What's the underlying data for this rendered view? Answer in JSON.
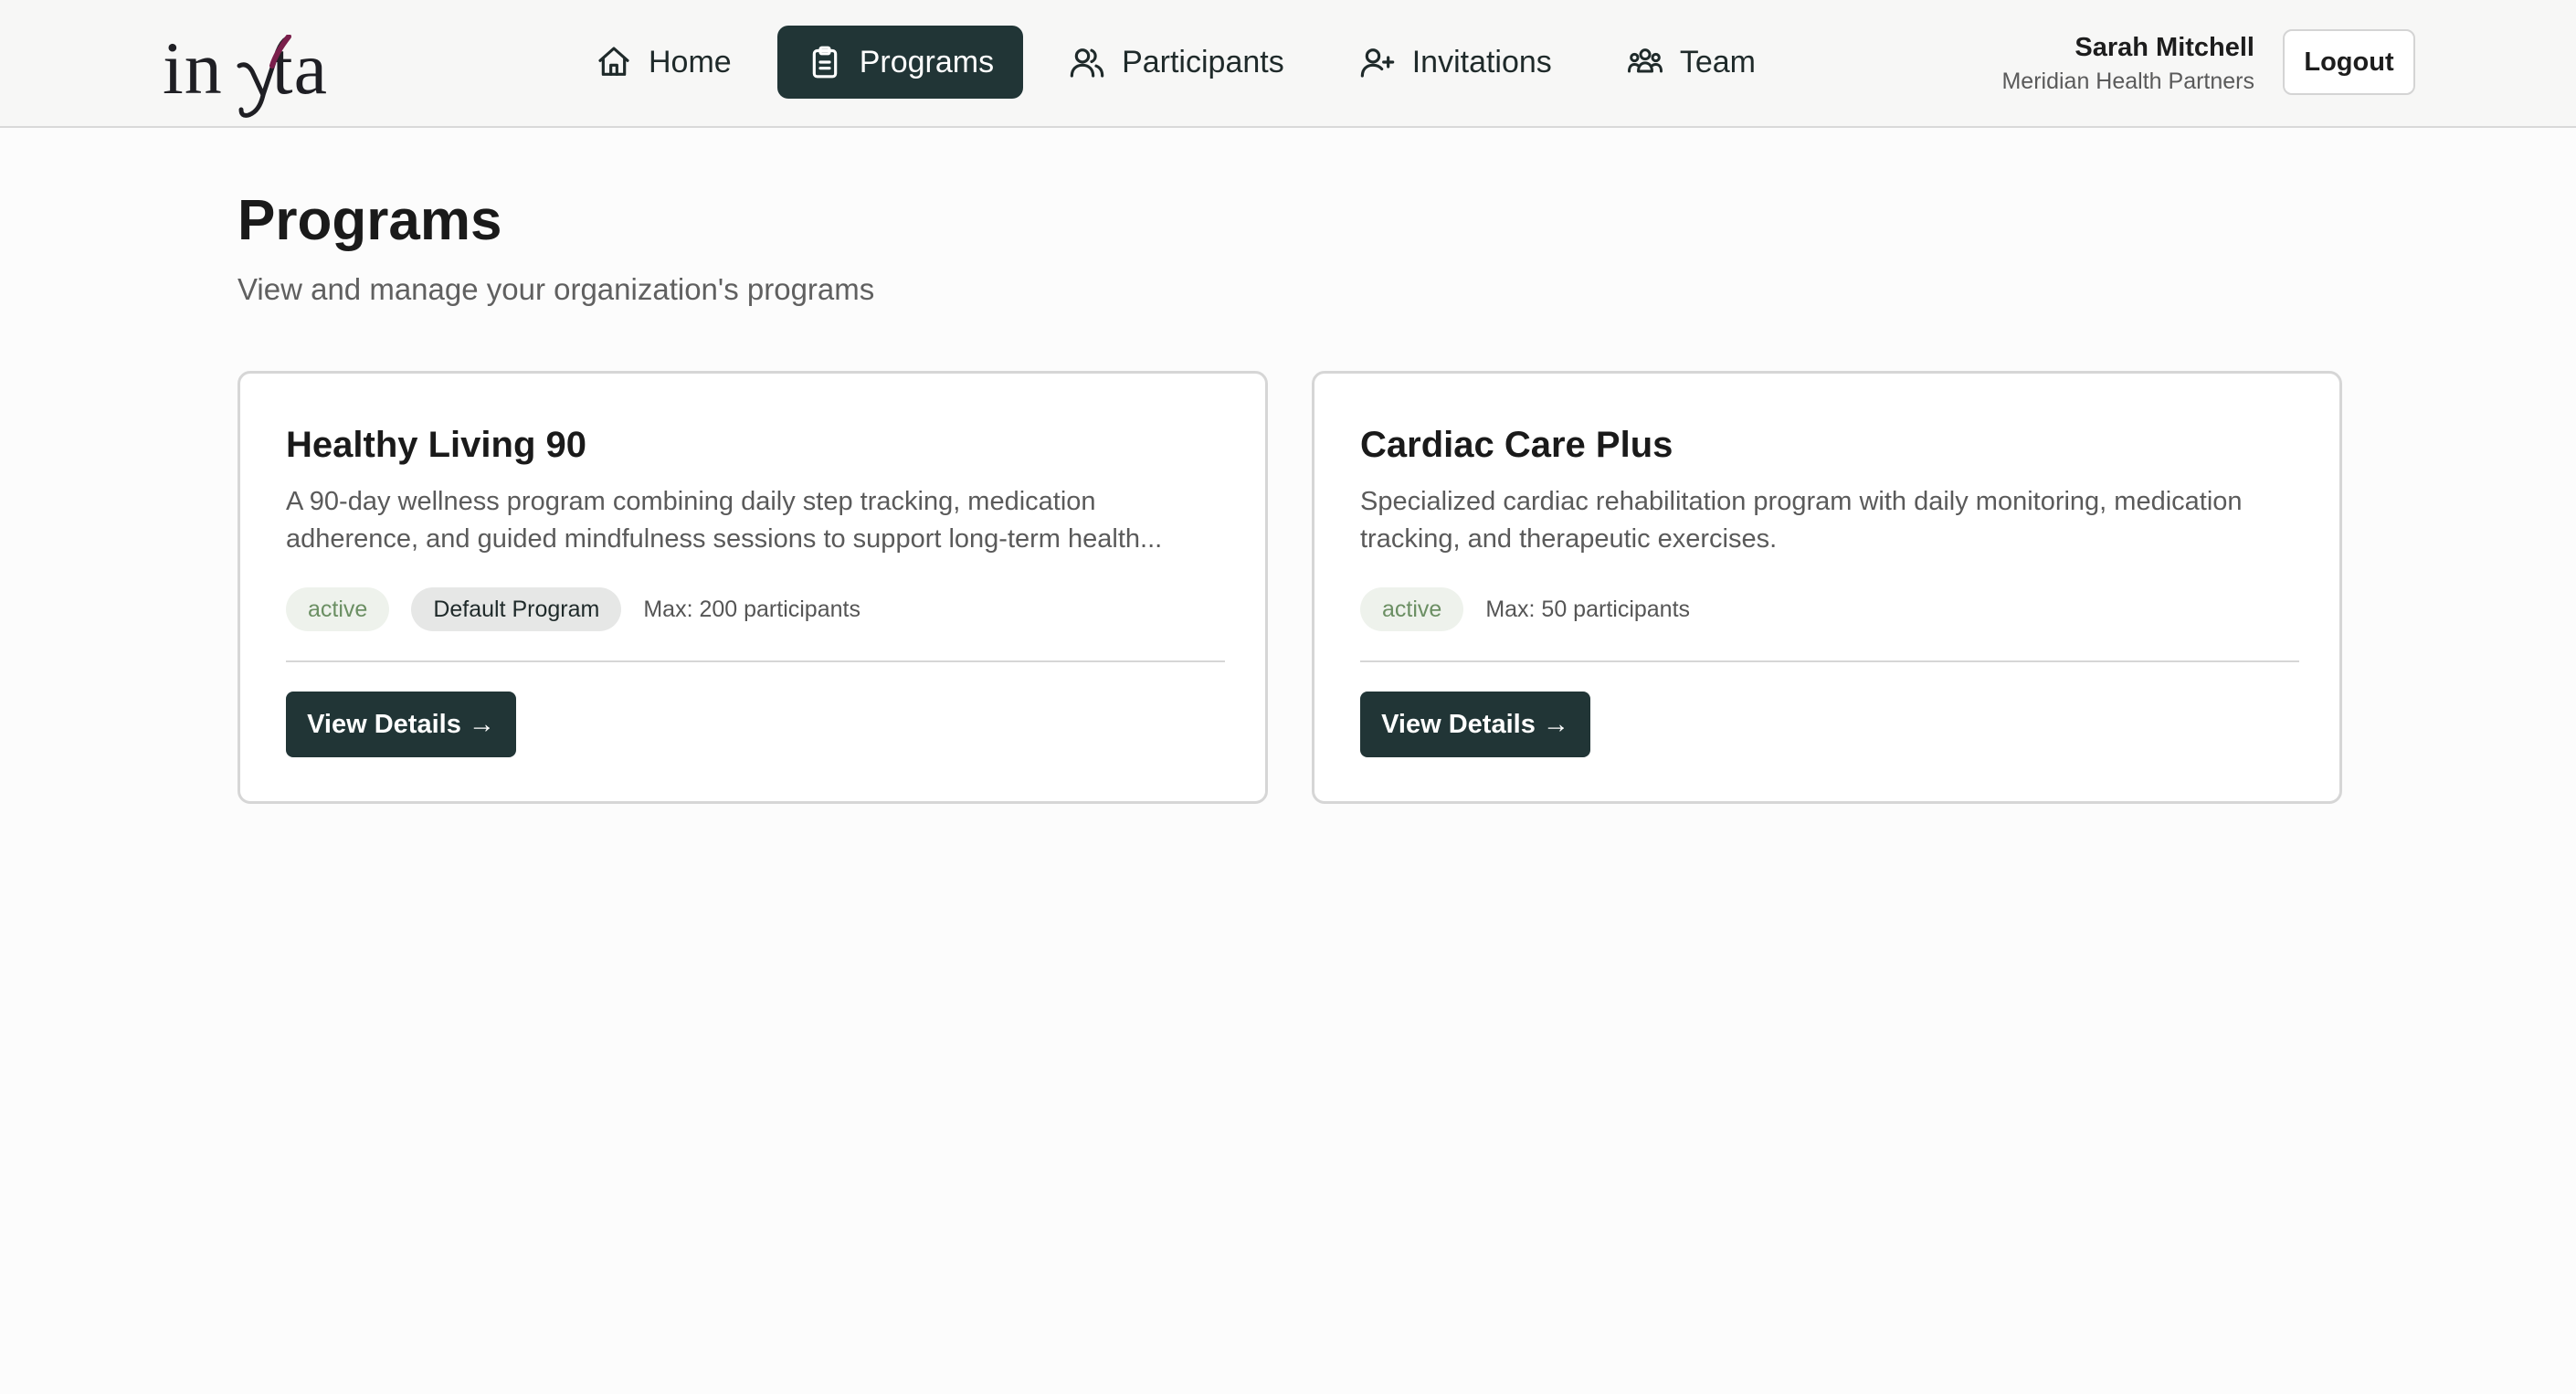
{
  "app": {
    "brand": "invyta",
    "brand_accent_color": "#7a1f4b",
    "primary_color": "#213536"
  },
  "nav": {
    "items": [
      {
        "label": "Home",
        "icon": "home-icon",
        "active": false
      },
      {
        "label": "Programs",
        "icon": "clipboard-icon",
        "active": true
      },
      {
        "label": "Participants",
        "icon": "users-icon",
        "active": false
      },
      {
        "label": "Invitations",
        "icon": "user-plus-icon",
        "active": false
      },
      {
        "label": "Team",
        "icon": "team-icon",
        "active": false
      }
    ]
  },
  "user": {
    "name": "Sarah Mitchell",
    "organization": "Meridian Health Partners",
    "logout_label": "Logout"
  },
  "page": {
    "title": "Programs",
    "subtitle": "View and manage your organization's programs"
  },
  "programs": [
    {
      "title": "Healthy Living 90",
      "description": "A 90-day wellness program combining daily step tracking, medication adherence, and guided mindfulness sessions to support long-term health...",
      "status": "active",
      "default_badge": "Default Program",
      "max_participants": "Max: 200 participants",
      "button_label": "View Details →"
    },
    {
      "title": "Cardiac Care Plus",
      "description": "Specialized cardiac rehabilitation program with daily monitoring, medication tracking, and therapeutic exercises.",
      "status": "active",
      "max_participants": "Max: 50 participants",
      "button_label": "View Details →"
    }
  ]
}
